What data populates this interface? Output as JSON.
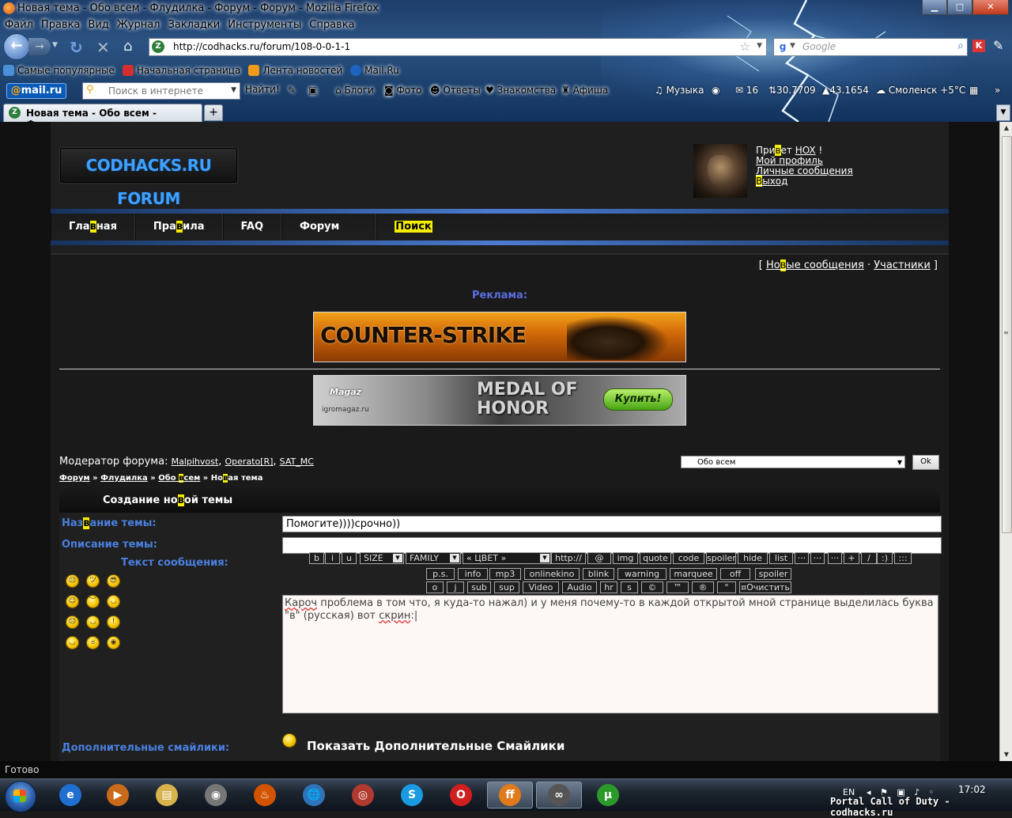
{
  "window": {
    "title": "Новая тема - Обо всем - Флудилка - Форум - Форум - Mozilla Firefox",
    "minimize": "▁",
    "maximize": "□",
    "close": "✕"
  },
  "menubar": [
    "Файл",
    "Правка",
    "Вид",
    "Журнал",
    "Закладки",
    "Инструменты",
    "Справка"
  ],
  "navbar": {
    "url": "http://codhacks.ru/forum/108-0-0-1-1",
    "search_placeholder": "Google"
  },
  "bookmarks": [
    {
      "label": "Самые популярные",
      "color": "#4a90d9"
    },
    {
      "label": "Начальная страница",
      "color": "#d32f2f"
    },
    {
      "label": "Лента новостей",
      "color": "#f09a1a"
    },
    {
      "label": "Mail.Ru",
      "color": "#1e63c0"
    }
  ],
  "mailru_toolbar": {
    "logo_prefix": "@",
    "logo_text": "mail.ru",
    "search_placeholder": "Поиск в интернете",
    "find_label": "Найти!",
    "items": [
      "Блоги",
      "Фото",
      "Ответы",
      "Знакомства",
      "Афиша",
      "Музыка",
      "16",
      "30.7709",
      "43.1654",
      "Смоленск +5°C"
    ]
  },
  "tab": {
    "title": "Новая тема - Обо всем - Флудилка ...",
    "new_tab": "+"
  },
  "site": {
    "logo": "CODHACKS.RU FORUM",
    "user": {
      "greeting_before": "При",
      "greeting_hl": "в",
      "greeting_after": "ет ",
      "username": "HOX",
      "exclaim": " !",
      "profile": "Мой профиль",
      "messages": "Личные сообщения",
      "logout_hl": "В",
      "logout_rest": "ыход"
    },
    "nav": [
      {
        "pre": "Гла",
        "hl": "в",
        "post": "ная"
      },
      {
        "pre": "Пра",
        "hl": "в",
        "post": "ила"
      },
      {
        "pre": "FAQ",
        "hl": "",
        "post": ""
      },
      {
        "pre": "Форум",
        "hl": "",
        "post": ""
      },
      {
        "pre": "",
        "hl": "Поиск",
        "post": ""
      }
    ],
    "toplinks": {
      "open": "[ ",
      "new_pre": "Но",
      "new_hl": "в",
      "new_post": "ые сообщения",
      "sep": " · ",
      "members": "Участники",
      "close": " ]"
    },
    "ad_label": "Реклама:",
    "banner1_text": "COUNTER-STRIKE",
    "banner2": {
      "magaz": "Magaz",
      "site": "igromagaz.ru",
      "title_line1": "MEDAL OF",
      "title_line2": "HONOR",
      "buy": "Купить!"
    },
    "moderators_label": "Модератор форума: ",
    "moderators": [
      "Malpihvost",
      "Operato[R]",
      "SAT_MC"
    ],
    "forum_select": "Обо всем",
    "ok": "Ok",
    "breadcrumbs": [
      {
        "pre": "Форум",
        "hl": "",
        "post": ""
      },
      {
        "pre": "Флудилка",
        "hl": "",
        "post": ""
      },
      {
        "pre": "Обо ",
        "hl": "в",
        "post": "сем"
      },
      {
        "pre": "Но",
        "hl": "в",
        "post": "ая тема"
      }
    ],
    "crumb_sep": " » ",
    "form": {
      "header_pre": "Создание но",
      "header_hl": "в",
      "header_post": "ой темы",
      "title_label_pre": "Наз",
      "title_label_hl": "в",
      "title_label_post": "ание темы:",
      "title_value": "Помогите))))срочно))",
      "desc_label": "Описание темы:",
      "desc_value": "",
      "text_label": "Текст сообщения:",
      "message_squiggle": "Кароч",
      "message_mid": " проблема в том что, я куда-то нажал) и у меня почему-то в каждой открытой мной странице выделилась буква \"в\" (русская) вот ",
      "message_squiggle2": "скрин",
      "message_end": ":",
      "extra_smiles_label": "Дополнительные смайлики:",
      "extra_smiles_link": "Показать Дополнительные Смайлики"
    },
    "toolbar_row1": [
      "b",
      "i",
      "u",
      "SIZE",
      "FAMILY",
      "« ЦВЕТ »",
      "http://",
      "@",
      "img",
      "quote",
      "code",
      "spoiler",
      "hide",
      "list",
      "···",
      "···",
      "···",
      "+",
      "/",
      ":)",
      ":::"
    ],
    "toolbar_row2": [
      "p.s.",
      "info",
      "mp3",
      "onlinekino",
      "blink",
      "warning",
      "marquee",
      "off",
      "spoiler"
    ],
    "toolbar_row3": [
      "o",
      "j",
      "sub",
      "sup",
      "Video",
      "Audio",
      "hr",
      "s",
      "©",
      "™",
      "®",
      "°",
      "¤Очистить ¤"
    ],
    "smiley_faces": [
      "☹",
      "ツ",
      "😎",
      "☺",
      "︶",
      "◡",
      "☹",
      "◡",
      "!",
      "◡",
      "ಠ",
      "◉"
    ]
  },
  "statusbar": "Готово",
  "taskbar": {
    "apps": [
      "e",
      "▶",
      "▤",
      "◉",
      "♨",
      "🌐",
      "◎",
      "S",
      "O",
      "ff",
      "∞",
      "µ"
    ],
    "lang": "EN",
    "tray_icons": "◂ ⚑ ▣ ♪ ◦",
    "clock": "17:02"
  },
  "watermark": "Portal Call of Duty - codhacks.ru"
}
